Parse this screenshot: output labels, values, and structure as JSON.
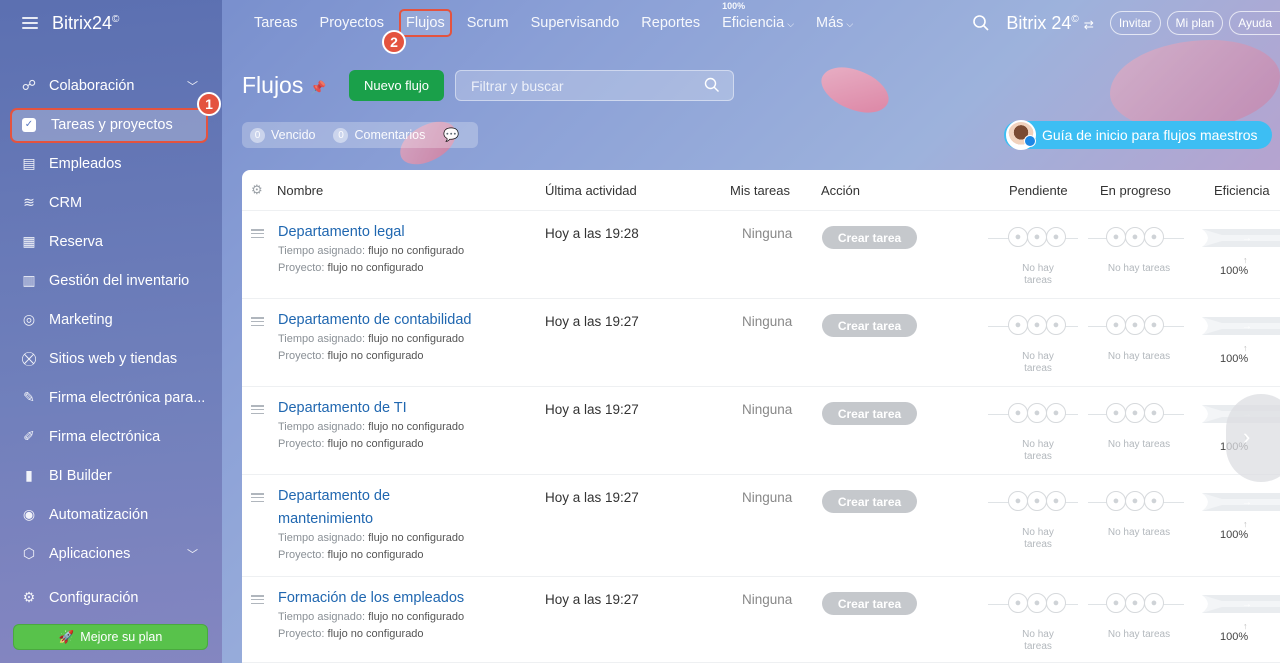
{
  "app": {
    "logo": "Bitrix24",
    "logo_mark": "©"
  },
  "topnav": {
    "items": [
      {
        "label": "Tareas"
      },
      {
        "label": "Proyectos"
      },
      {
        "label": "Flujos",
        "selected": true
      },
      {
        "label": "Scrum"
      },
      {
        "label": "Supervisando"
      },
      {
        "label": "Reportes"
      },
      {
        "label": "Eficiencia",
        "sup": "100%",
        "dropdown": true
      },
      {
        "label": "Más",
        "dropdown": true
      }
    ],
    "right_logo": "Bitrix 24",
    "invite": "Invitar",
    "my_plan": "Mi plan",
    "help": "Ayuda"
  },
  "sidebar": {
    "items": [
      {
        "label": "Colaboración",
        "icon": "collaboration-icon",
        "chevron": true
      },
      {
        "label": "Tareas y proyectos",
        "icon": "checkbox-icon",
        "active": true
      },
      {
        "label": "Empleados",
        "icon": "employees-icon"
      },
      {
        "label": "CRM",
        "icon": "crm-icon"
      },
      {
        "label": "Reserva",
        "icon": "calendar-icon"
      },
      {
        "label": "Gestión del inventario",
        "icon": "inventory-icon"
      },
      {
        "label": "Marketing",
        "icon": "marketing-icon"
      },
      {
        "label": "Sitios web y tiendas",
        "icon": "cart-icon"
      },
      {
        "label": "Firma electrónica para...",
        "icon": "doc-sign-icon"
      },
      {
        "label": "Firma electrónica",
        "icon": "pen-icon"
      },
      {
        "label": "BI Builder",
        "icon": "bar-chart-icon"
      },
      {
        "label": "Automatización",
        "icon": "robot-icon"
      },
      {
        "label": "Aplicaciones",
        "icon": "cube-icon",
        "chevron": true
      }
    ],
    "config": "Configuración",
    "upgrade": "Mejore su plan"
  },
  "callouts": {
    "one": "1",
    "two": "2"
  },
  "page": {
    "title": "Flujos",
    "new_button": "Nuevo flujo",
    "search_placeholder": "Filtrar y buscar",
    "counters": [
      {
        "count": "0",
        "label": "Vencido"
      },
      {
        "count": "0",
        "label": "Comentarios"
      }
    ],
    "guide": "Guía de inicio para flujos maestros"
  },
  "table": {
    "headers": {
      "name": "Nombre",
      "activity": "Última actividad",
      "mine": "Mis tareas",
      "action": "Acción",
      "pending": "Pendiente",
      "progress": "En progreso",
      "efficiency": "Eficiencia"
    },
    "time_label": "Tiempo asignado:",
    "project_label": "Proyecto:",
    "not_configured": "flujo no configurado",
    "create_task": "Crear tarea",
    "no_tasks": "No hay tareas",
    "rows": [
      {
        "name": "Departamento legal",
        "activity": "Hoy a las 19:28",
        "mine": "Ninguna",
        "efficiency": "100%"
      },
      {
        "name": "Departamento de contabilidad",
        "activity": "Hoy a las 19:27",
        "mine": "Ninguna",
        "efficiency": "100%"
      },
      {
        "name": "Departamento de TI",
        "activity": "Hoy a las 19:27",
        "mine": "Ninguna",
        "efficiency": "100%"
      },
      {
        "name": "Departamento de mantenimiento",
        "activity": "Hoy a las 19:27",
        "mine": "Ninguna",
        "efficiency": "100%"
      },
      {
        "name": "Formación de los empleados",
        "activity": "Hoy a las 19:27",
        "mine": "Ninguna",
        "efficiency": "100%"
      }
    ]
  }
}
